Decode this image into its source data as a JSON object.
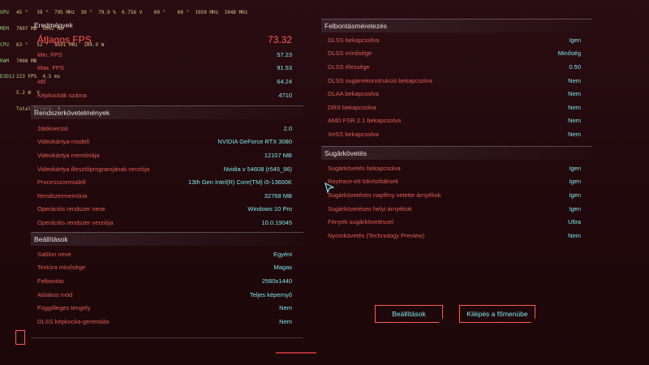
{
  "overlay": {
    "rows": [
      {
        "label": "GPU",
        "text": "45 °   39 °  795 MHz  30 °  79.9 %  0.756 V    60 °    60 °  1050 MHz  1048 MHz"
      },
      {
        "label": "MEM",
        "text": "7607 MB  5002 MB"
      },
      {
        "label": "CPU",
        "text": "63 °   52 °  5591 MHz  104.9 W"
      },
      {
        "label": "RAM",
        "text": "7008 MB"
      },
      {
        "label": "D3D12",
        "text": "223 FPS  4.5 ms"
      },
      {
        "label": "",
        "text": "5.2 W  V"
      },
      {
        "label": "",
        "text": "Total Errors: 0"
      }
    ]
  },
  "results": {
    "title": "Eredmények",
    "avg_label": "Átlagos FPS",
    "avg_value": "73.32",
    "items": [
      {
        "label": "Min. FPS",
        "value": "57.23"
      },
      {
        "label": "Max. FPS",
        "value": "91.53"
      },
      {
        "label": "Idő",
        "value": "64.24"
      },
      {
        "label": "Képkockák száma",
        "value": "4710"
      }
    ]
  },
  "system": {
    "title": "Rendszerkövetelmények",
    "items": [
      {
        "label": "Játékverzió",
        "value": "2.0"
      },
      {
        "label": "Videokártya-modell",
        "value": "NVIDIA GeForce RTX 3080"
      },
      {
        "label": "Videokártya memóriája",
        "value": "12107 MB"
      },
      {
        "label": "Videokártya illesztőprogramjának verziója",
        "value": "Nvidia v 54608 (r545_96)"
      },
      {
        "label": "Processzormodell",
        "value": "13th Gen Intel(R) Core(TM) i5-13600K"
      },
      {
        "label": "Rendszermemória",
        "value": "32768 MB"
      },
      {
        "label": "Operációs rendszer neve",
        "value": "Windows 10 Pro"
      },
      {
        "label": "Operációs rendszer verziója",
        "value": "10.0.19045"
      }
    ]
  },
  "settings": {
    "title": "Beállítások",
    "items": [
      {
        "label": "Sablon neve",
        "value": "Egyéni"
      },
      {
        "label": "Textúra minősége",
        "value": "Magas"
      },
      {
        "label": "Felbontás",
        "value": "2560x1440"
      },
      {
        "label": "Ablakos mód",
        "value": "Teljes képernyő"
      },
      {
        "label": "Függőleges tengely",
        "value": "Nem"
      },
      {
        "label": "DLSS képkocka-generálás",
        "value": "Nem"
      }
    ]
  },
  "upscaling": {
    "title": "Felbontásméretezés",
    "items": [
      {
        "label": "DLSS bekapcsolva",
        "value": "Igen"
      },
      {
        "label": "DLSS minősége",
        "value": "Minőség"
      },
      {
        "label": "DLSS élessége",
        "value": "0.50"
      },
      {
        "label": "DLSS sugárrekonstrukció bekapcsolva",
        "value": "Nem"
      },
      {
        "label": "DLAA bekapcsolva",
        "value": "Nem"
      },
      {
        "label": "DRS bekapcsolva",
        "value": "Nem"
      },
      {
        "label": "AMD FSR 2.1 bekapcsolva",
        "value": "Nem"
      },
      {
        "label": "XeSS bekapcsolva",
        "value": "Nem"
      }
    ]
  },
  "raytracing": {
    "title": "Sugárkövetés",
    "items": [
      {
        "label": "Sugárkövetés bekapcsolva",
        "value": "Igen"
      },
      {
        "label": "Raytrace-elt tükröződések",
        "value": "Igen"
      },
      {
        "label": "Sugárkövetéses napfény vetette árnyékok",
        "value": "Igen"
      },
      {
        "label": "Sugárkövetéses helyi árnyékok",
        "value": "Igen"
      },
      {
        "label": "Fények sugárkövetéssel",
        "value": "Ultra"
      },
      {
        "label": "Nyomkövetés (Technology Preview)",
        "value": "Nem"
      }
    ]
  },
  "buttons": {
    "settings": "Beállítások",
    "exit": "Kilépés a főmenübe"
  }
}
